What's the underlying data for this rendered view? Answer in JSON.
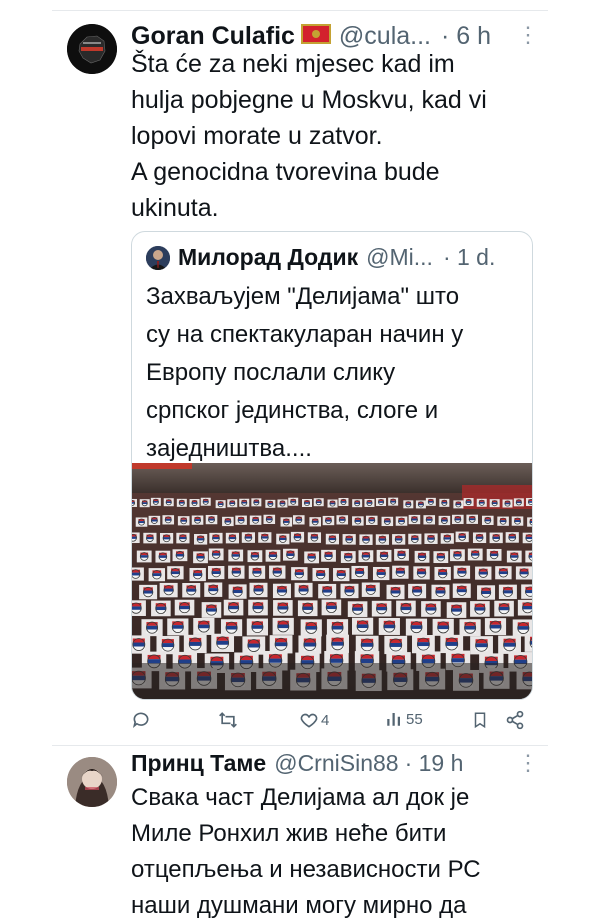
{
  "tweet1": {
    "name": "Goran Culafic",
    "handle": "@cula...",
    "time": "· 6 h",
    "text_lines": [
      "Šta će za neki mjesec kad im",
      "hulja pobjegne u Moskvu, kad vi",
      "lopovi morate u zatvor.",
      "A genocidna tvorevina bude",
      "ukinuta."
    ]
  },
  "quote": {
    "name": "Милорад Додик",
    "handle": "@Mi...",
    "time": "· 1 d.",
    "text_lines": [
      "Захваљујем \"Делијама\" што",
      "су на спектакуларан начин у",
      "Европу послали слику",
      "српског јединства, слоге и",
      "заједништва...."
    ]
  },
  "actions": {
    "likes": "4",
    "views": "55"
  },
  "tweet2": {
    "name": "Принц Таме",
    "handle": "@CrniSin88",
    "time": "· 19 h",
    "text_lines": [
      "Свака част Делијама ал док је",
      "Миле Ронхил жив неће бити",
      "отцепљења и независности РС",
      "наши душмани могу мирно да"
    ]
  },
  "colors": {
    "text": "#0f1419",
    "secondary": "#536471",
    "border": "#cfd9de",
    "divider": "#e6e9ec"
  },
  "icons": [
    "montenegro-flag-icon",
    "more-icon",
    "reply-icon",
    "retweet-icon",
    "like-icon",
    "views-icon",
    "bookmark-icon",
    "share-icon"
  ]
}
